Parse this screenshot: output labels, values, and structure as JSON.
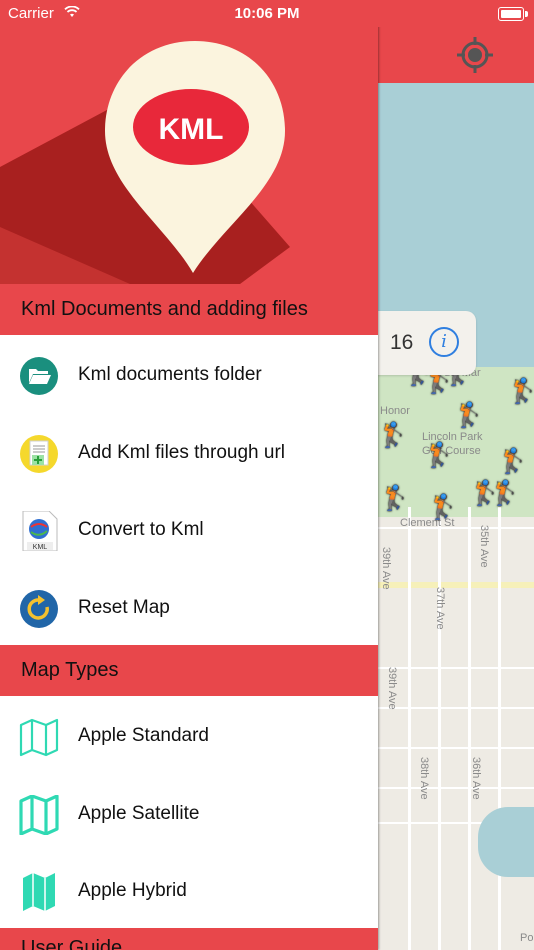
{
  "status_bar": {
    "carrier": "Carrier",
    "time": "10:06 PM"
  },
  "map": {
    "callout_number": "16",
    "labels": {
      "del_mar": "del Mar",
      "honor": "Honor",
      "lincoln_park": "Lincoln Park",
      "golf_course": "Golf Course",
      "clement_st": "Clement St",
      "th39_ave_a": "39th Ave",
      "th35_ave": "35th Ave",
      "th37_ave": "37th Ave",
      "th39_ave_b": "39th Ave",
      "th38_ave": "38th Ave",
      "th36_ave": "36th Ave",
      "po": "Po"
    }
  },
  "drawer": {
    "sections": [
      {
        "title": "Kml Documents and adding files",
        "items": [
          {
            "label": "Kml documents folder",
            "icon": "folder-icon"
          },
          {
            "label": "Add Kml files through url",
            "icon": "add-file-icon"
          },
          {
            "label": "Convert to Kml",
            "icon": "kml-file-icon"
          },
          {
            "label": "Reset Map",
            "icon": "reset-icon"
          }
        ]
      },
      {
        "title": "Map Types",
        "items": [
          {
            "label": "Apple Standard",
            "icon": "map-outline-icon"
          },
          {
            "label": "Apple Satellite",
            "icon": "map-satellite-icon"
          },
          {
            "label": "Apple Hybrid",
            "icon": "map-hybrid-icon"
          }
        ]
      },
      {
        "title": "User Guide"
      }
    ],
    "logo_text": "KML",
    "kml_file_caption": "KML"
  },
  "colors": {
    "accent": "#e8474b",
    "teal": "#1a8f7e",
    "map_icon": "#2fd9b3"
  }
}
